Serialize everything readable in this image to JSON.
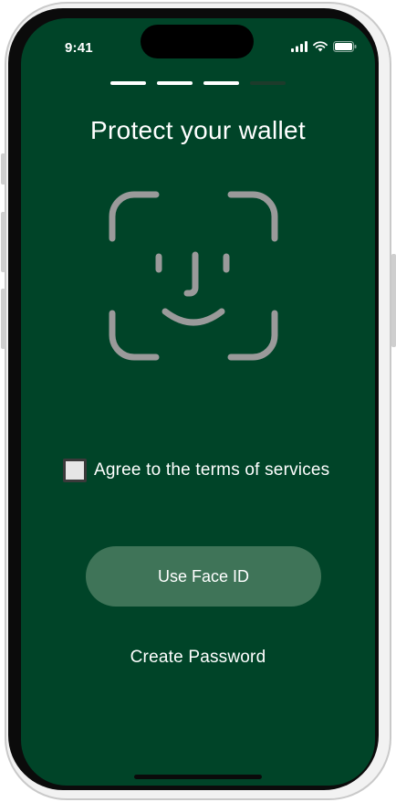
{
  "status_bar": {
    "time": "9:41",
    "icons": [
      "cellular-signal-icon",
      "wifi-icon",
      "battery-icon"
    ]
  },
  "onboarding": {
    "steps_total": 4,
    "current_step": 3
  },
  "screen": {
    "title": "Protect your wallet",
    "illustration": "face-id-icon"
  },
  "terms": {
    "label": "Agree to the terms of services",
    "checked": false
  },
  "actions": {
    "primary_label": "Use Face ID",
    "secondary_label": "Create Password"
  },
  "colors": {
    "background": "#004428",
    "primary_button": "#3f7458",
    "text": "#ffffff",
    "face_icon": "#9a9a9a"
  }
}
